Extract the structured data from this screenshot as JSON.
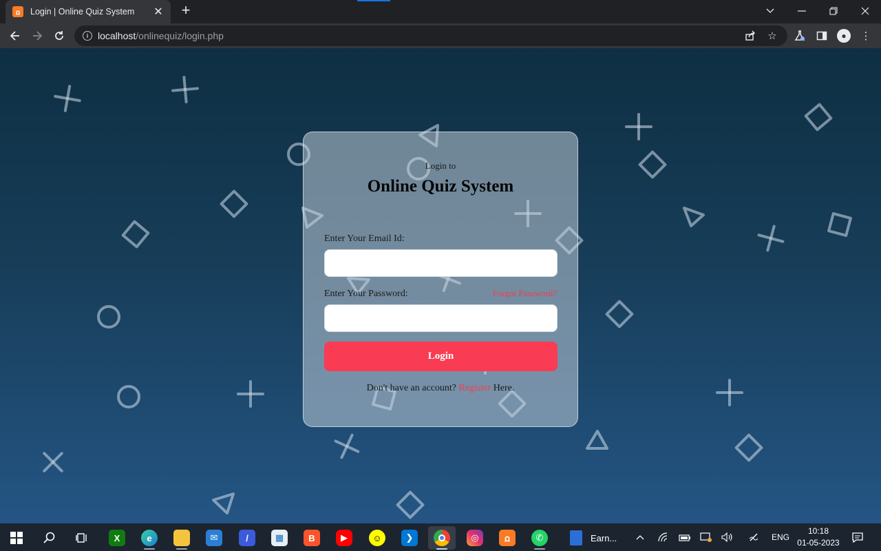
{
  "browser": {
    "tab_title": "Login | Online Quiz System",
    "favicon_text": "ꭥ",
    "url_host": "localhost",
    "url_path": "/onlinequiz/login.php",
    "accent": "#1a73e8"
  },
  "page": {
    "subtitle": "Login to",
    "title": "Online Quiz System",
    "email_label": "Enter Your Email Id:",
    "email_value": "",
    "password_label": "Enter Your Password:",
    "password_value": "",
    "forgot_label": "Forgot Password?",
    "login_label": "Login",
    "register_prefix": "Don't have an account?",
    "register_link": "Register",
    "register_suffix": "Here.",
    "accent_color": "#f93b54"
  },
  "taskbar": {
    "apps": [
      "start-icon",
      "search-icon",
      "task-view-icon",
      "xbox-icon",
      "edge-icon",
      "file-explorer-icon",
      "mail-icon",
      "visual-studio-icon",
      "store-icon",
      "brave-icon",
      "youtube-icon",
      "snapchat-icon",
      "vscode-icon",
      "chrome-dev-icon",
      "instagram-icon",
      "xampp-icon",
      "whatsapp-icon"
    ],
    "running_window_label": "Earn...",
    "language": "ENG",
    "time": "10:18",
    "date": "01-05-2023"
  }
}
